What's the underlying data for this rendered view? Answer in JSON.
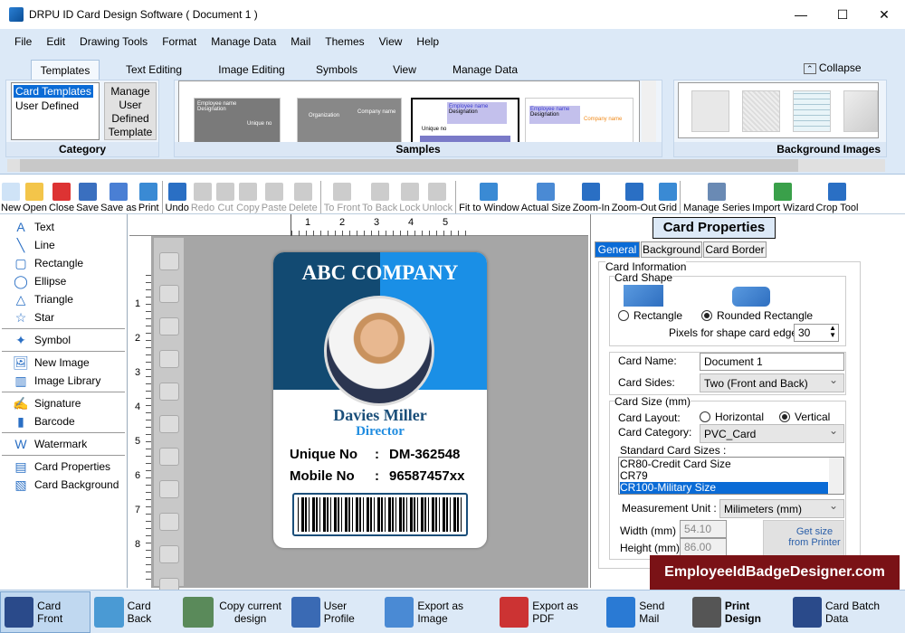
{
  "window": {
    "title": "DRPU ID Card Design Software ( Document 1 )",
    "controls": [
      "minimize",
      "maximize",
      "close"
    ]
  },
  "menu": [
    "File",
    "Edit",
    "Drawing Tools",
    "Format",
    "Manage Data",
    "Mail",
    "Themes",
    "View",
    "Help"
  ],
  "ribbon": {
    "tabs": [
      "Templates",
      "Text Editing",
      "Image Editing",
      "Symbols",
      "View",
      "Manage Data"
    ],
    "collapse": "Collapse",
    "category": {
      "label": "Category",
      "items": [
        "Card Templates",
        "User Defined"
      ],
      "manage_button": "Manage User Defined Template"
    },
    "samples": {
      "label": "Samples",
      "thumbs": [
        {
          "t1": "Employee name",
          "t2": "Designation",
          "t3": "Unique no"
        },
        {
          "t1": "Organization",
          "t2": "Company name"
        },
        {
          "t1": "Employee name",
          "t2": "Designation",
          "t3": "Unique no"
        },
        {
          "t1": "Employee name",
          "t2": "Designation",
          "t3": "Company name"
        }
      ]
    },
    "background_images": {
      "label": "Background Images"
    }
  },
  "toolbar": [
    "New",
    "Open",
    "Close",
    "Save",
    "Save as",
    "Print",
    "Undo",
    "Redo",
    "Cut",
    "Copy",
    "Paste",
    "Delete",
    "To Front",
    "To Back",
    "Lock",
    "Unlock",
    "Fit to Window",
    "Actual Size",
    "Zoom-In",
    "Zoom-Out",
    "Grid",
    "Manage Series",
    "Import Wizard",
    "Crop Tool"
  ],
  "toolbar_disabled": [
    "Redo",
    "Cut",
    "Copy",
    "Paste",
    "Delete",
    "To Front",
    "To Back",
    "Lock",
    "Unlock"
  ],
  "left_tools": [
    "Text",
    "Line",
    "Rectangle",
    "Ellipse",
    "Triangle",
    "Star",
    "Symbol",
    "New Image",
    "Image Library",
    "Signature",
    "Barcode",
    "Watermark",
    "Card Properties",
    "Card Background"
  ],
  "ruler": {
    "top": [
      "1",
      "2",
      "3",
      "4",
      "5"
    ],
    "left": [
      "1",
      "2",
      "3",
      "4",
      "5",
      "6",
      "7",
      "8"
    ]
  },
  "card": {
    "company": "ABC COMPANY",
    "name": "Davies Miller",
    "designation": "Director",
    "unique_label": "Unique No",
    "unique_value": "DM-362548",
    "mobile_label": "Mobile No",
    "mobile_value": "96587457xx",
    "colors": {
      "dark": "#124a72",
      "light": "#1a8fe6",
      "name": "#1b4f7a",
      "title": "#1f8ce0"
    }
  },
  "properties": {
    "title": "Card Properties",
    "tabs": [
      "General",
      "Background",
      "Card Border"
    ],
    "card_information": "Card Information",
    "card_shape": "Card Shape",
    "shape_options": [
      "Rectangle",
      "Rounded Rectangle"
    ],
    "shape_selected": "Rounded Rectangle",
    "edge_label": "Pixels for shape card edge :",
    "edge_value": "30",
    "card_name_label": "Card Name:",
    "card_name": "Document 1",
    "card_sides_label": "Card Sides:",
    "card_sides": "Two (Front and Back)",
    "card_size": "Card Size (mm)",
    "layout_label": "Card Layout:",
    "layout_options": [
      "Horizontal",
      "Vertical"
    ],
    "layout_selected": "Vertical",
    "category_label": "Card Category:",
    "category": "PVC_Card",
    "standard_label": "Standard Card Sizes :",
    "standard_sizes": [
      "CR80-Credit Card Size",
      "CR79",
      "CR100-Military Size"
    ],
    "standard_selected": "CR100-Military Size",
    "unit_label": "Measurement Unit :",
    "unit": "Milimeters (mm)",
    "width_label": "Width  (mm)",
    "width": "54.10",
    "height_label": "Height  (mm)",
    "height": "86.00",
    "printer_button": "Get size from Printer"
  },
  "watermark": "EmployeeIdBadgeDesigner.com",
  "bottom": [
    "Card Front",
    "Card Back",
    "Copy current design",
    "User Profile",
    "Export as Image",
    "Export as PDF",
    "Send Mail",
    "Print Design",
    "Card Batch Data"
  ],
  "bottom_active": "Card Front"
}
